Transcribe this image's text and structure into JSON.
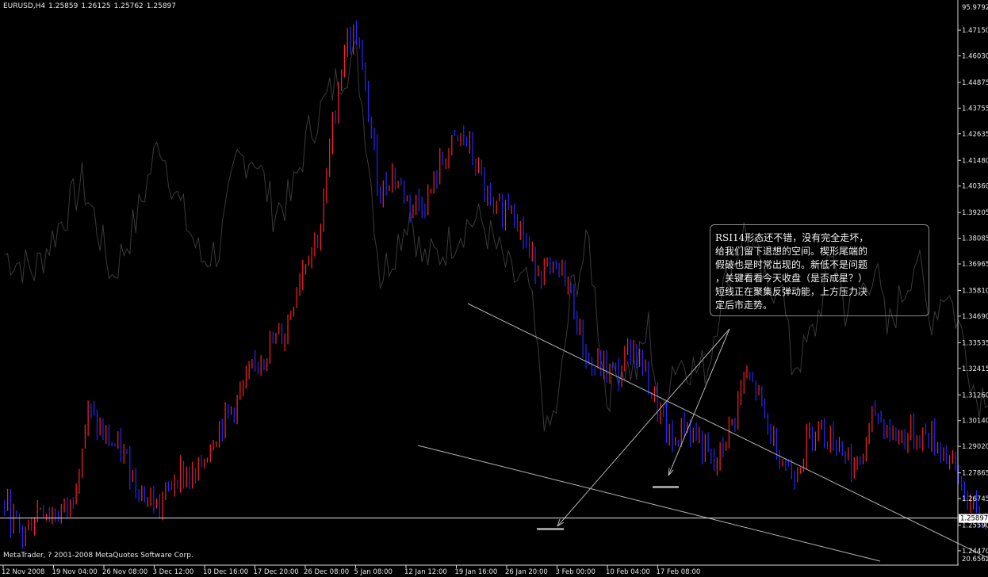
{
  "header": {
    "symbol": "EURUSD,H4",
    "open": "1.25859",
    "high": "1.26125",
    "low": "1.25762",
    "close": "1.25897"
  },
  "copyright": "MetaTrader, ? 2001-2008 MetaQuotes Software Corp.",
  "annotation": {
    "lines": [
      "RSI14形态还不错，没有完全走坏，",
      "给我们留下退想的空间。楔形尾端的",
      "假破也是时常出现的。新低不是问题",
      "，关键看看今天收盘（是否成星？）",
      "短线正在聚集反弹动能，上方压力决",
      "定后市走势。"
    ]
  },
  "colors": {
    "background": "#000000",
    "bull_bar": "#ff2020",
    "bear_bar": "#2626ff",
    "rsi_line": "#3a3a3a",
    "axis": "#d8d8d8",
    "trendline": "#b4b4b4",
    "marker": "#9a9a9a",
    "text": "#e8e8e8"
  },
  "chart_data": {
    "type": "candlestick",
    "ylim": [
      1.2388,
      1.4798
    ],
    "price_ticks": [
      "1.47150",
      "1.46030",
      "1.44875",
      "1.43755",
      "1.42635",
      "1.41480",
      "1.40360",
      "1.39205",
      "1.38085",
      "1.36965",
      "1.35810",
      "1.34690",
      "1.33535",
      "1.32415",
      "1.31260",
      "1.30140",
      "1.29020",
      "1.27865",
      "1.26745",
      "1.25590",
      "1.24470"
    ],
    "indicator_ticks": {
      "top": "95.9792",
      "bottom": "20.6562"
    },
    "current_price": "1.25897",
    "time_labels": [
      "12 Nov 2008",
      "19 Nov 04:00",
      "26 Nov 08:00",
      "3 Dec 12:00",
      "10 Dec 16:00",
      "17 Dec 20:00",
      "26 Dec 08:00",
      "5 Jan 08:00",
      "12 Jan 12:00",
      "19 Jan 16:00",
      "26 Jan 20:00",
      "3 Feb 00:00",
      "10 Feb 04:00",
      "17 Feb 08:00"
    ],
    "bar_count": 280,
    "price_path": [
      [
        0,
        1.265
      ],
      [
        6,
        1.251
      ],
      [
        12,
        1.265
      ],
      [
        16,
        1.26
      ],
      [
        22,
        1.264
      ],
      [
        28,
        1.305
      ],
      [
        33,
        1.295
      ],
      [
        40,
        1.286
      ],
      [
        46,
        1.27
      ],
      [
        52,
        1.264
      ],
      [
        58,
        1.279
      ],
      [
        64,
        1.276
      ],
      [
        70,
        1.295
      ],
      [
        78,
        1.31
      ],
      [
        86,
        1.33
      ],
      [
        94,
        1.34
      ],
      [
        100,
        1.37
      ],
      [
        106,
        1.385
      ],
      [
        110,
        1.43
      ],
      [
        114,
        1.465
      ],
      [
        118,
        1.47
      ],
      [
        122,
        1.435
      ],
      [
        126,
        1.4
      ],
      [
        130,
        1.41
      ],
      [
        136,
        1.395
      ],
      [
        142,
        1.398
      ],
      [
        148,
        1.418
      ],
      [
        154,
        1.425
      ],
      [
        158,
        1.413
      ],
      [
        164,
        1.39
      ],
      [
        170,
        1.398
      ],
      [
        176,
        1.373
      ],
      [
        182,
        1.365
      ],
      [
        188,
        1.365
      ],
      [
        192,
        1.345
      ],
      [
        196,
        1.325
      ],
      [
        200,
        1.325
      ],
      [
        206,
        1.321
      ],
      [
        210,
        1.335
      ],
      [
        214,
        1.325
      ],
      [
        218,
        1.31
      ],
      [
        224,
        1.29
      ],
      [
        228,
        1.3
      ],
      [
        232,
        1.295
      ],
      [
        238,
        1.28
      ],
      [
        244,
        1.3
      ],
      [
        248,
        1.32
      ],
      [
        252,
        1.315
      ],
      [
        256,
        1.298
      ],
      [
        260,
        1.288
      ],
      [
        264,
        1.278
      ],
      [
        268,
        1.288
      ],
      [
        272,
        1.3
      ],
      [
        276,
        1.295
      ],
      [
        280,
        1.292
      ],
      [
        286,
        1.279
      ],
      [
        292,
        1.305
      ],
      [
        298,
        1.295
      ],
      [
        304,
        1.295
      ],
      [
        310,
        1.295
      ],
      [
        316,
        1.287
      ],
      [
        322,
        1.27
      ],
      [
        326,
        1.259
      ],
      [
        330,
        1.258
      ]
    ],
    "rsi_path": [
      [
        0,
        0.56
      ],
      [
        10,
        0.53
      ],
      [
        20,
        0.63
      ],
      [
        26,
        0.69
      ],
      [
        30,
        0.63
      ],
      [
        36,
        0.52
      ],
      [
        44,
        0.62
      ],
      [
        52,
        0.77
      ],
      [
        58,
        0.66
      ],
      [
        66,
        0.55
      ],
      [
        72,
        0.57
      ],
      [
        78,
        0.73
      ],
      [
        84,
        0.74
      ],
      [
        90,
        0.64
      ],
      [
        96,
        0.66
      ],
      [
        102,
        0.78
      ],
      [
        108,
        0.84
      ],
      [
        112,
        0.88
      ],
      [
        118,
        0.92
      ],
      [
        122,
        0.74
      ],
      [
        126,
        0.52
      ],
      [
        130,
        0.56
      ],
      [
        136,
        0.64
      ],
      [
        140,
        0.55
      ],
      [
        146,
        0.56
      ],
      [
        152,
        0.6
      ],
      [
        156,
        0.62
      ],
      [
        160,
        0.62
      ],
      [
        166,
        0.56
      ],
      [
        170,
        0.52
      ],
      [
        176,
        0.5
      ],
      [
        182,
        0.23
      ],
      [
        186,
        0.3
      ],
      [
        190,
        0.49
      ],
      [
        196,
        0.58
      ],
      [
        202,
        0.3
      ],
      [
        206,
        0.36
      ],
      [
        212,
        0.35
      ],
      [
        216,
        0.43
      ],
      [
        220,
        0.27
      ],
      [
        224,
        0.36
      ],
      [
        228,
        0.37
      ],
      [
        232,
        0.35
      ],
      [
        236,
        0.36
      ],
      [
        240,
        0.48
      ],
      [
        244,
        0.54
      ],
      [
        248,
        0.6
      ],
      [
        252,
        0.56
      ],
      [
        256,
        0.48
      ],
      [
        260,
        0.53
      ],
      [
        264,
        0.36
      ],
      [
        268,
        0.38
      ],
      [
        272,
        0.43
      ],
      [
        278,
        0.57
      ],
      [
        282,
        0.46
      ],
      [
        288,
        0.5
      ],
      [
        292,
        0.54
      ],
      [
        296,
        0.42
      ],
      [
        302,
        0.5
      ],
      [
        306,
        0.56
      ],
      [
        310,
        0.44
      ],
      [
        316,
        0.5
      ],
      [
        322,
        0.4
      ],
      [
        326,
        0.3
      ],
      [
        330,
        0.32
      ]
    ]
  }
}
